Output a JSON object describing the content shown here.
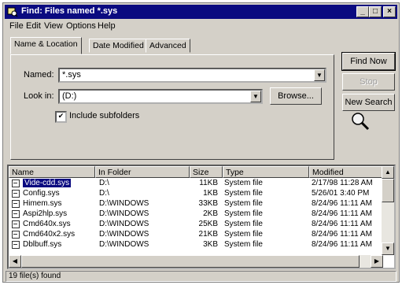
{
  "window": {
    "title": "Find: Files named *.sys"
  },
  "menu": [
    "File",
    "Edit",
    "View",
    "Options",
    "Help"
  ],
  "tabs": [
    "Name & Location",
    "Date Modified",
    "Advanced"
  ],
  "form": {
    "named_label": "Named:",
    "named_value": "*.sys",
    "lookin_label": "Look in:",
    "lookin_value": "(D:)",
    "browse_label": "Browse...",
    "include_subfolders_label": "Include subfolders",
    "include_subfolders_checked": true
  },
  "buttons": {
    "find_now": "Find Now",
    "stop": "Stop",
    "new_search": "New Search"
  },
  "results": {
    "columns": [
      "Name",
      "In Folder",
      "Size",
      "Type",
      "Modified"
    ],
    "rows": [
      {
        "name": "Vide-cdd.sys",
        "folder": "D:\\",
        "size": "11KB",
        "type": "System file",
        "modified": "2/17/98 11:28 AM",
        "selected": true
      },
      {
        "name": "Config.sys",
        "folder": "D:\\",
        "size": "1KB",
        "type": "System file",
        "modified": "5/26/01 3:40 PM"
      },
      {
        "name": "Himem.sys",
        "folder": "D:\\WINDOWS",
        "size": "33KB",
        "type": "System file",
        "modified": "8/24/96 11:11 AM"
      },
      {
        "name": "Aspi2hlp.sys",
        "folder": "D:\\WINDOWS",
        "size": "2KB",
        "type": "System file",
        "modified": "8/24/96 11:11 AM"
      },
      {
        "name": "Cmd640x.sys",
        "folder": "D:\\WINDOWS",
        "size": "25KB",
        "type": "System file",
        "modified": "8/24/96 11:11 AM"
      },
      {
        "name": "Cmd640x2.sys",
        "folder": "D:\\WINDOWS",
        "size": "21KB",
        "type": "System file",
        "modified": "8/24/96 11:11 AM"
      },
      {
        "name": "Dblbuff.sys",
        "folder": "D:\\WINDOWS",
        "size": "3KB",
        "type": "System file",
        "modified": "8/24/96 11:11 AM"
      }
    ]
  },
  "status": {
    "text": "19 file(s) found"
  },
  "colors": {
    "titlebar": "#0a0a80",
    "face": "#d4d0c8",
    "selection": "#0a0a80"
  },
  "icons": [
    "find-app-icon",
    "magnifier-icon",
    "system-file-icon",
    "check-icon",
    "dropdown-arrow-icon"
  ]
}
